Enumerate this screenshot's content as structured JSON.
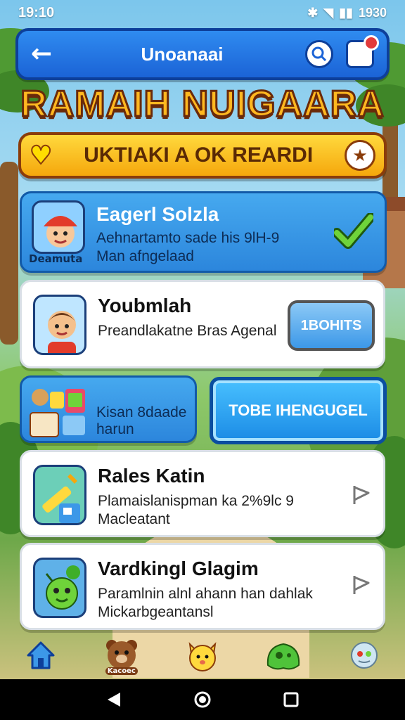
{
  "status_bar": {
    "time": "19:10",
    "right_time": "1930"
  },
  "header": {
    "title": "Unoanaai"
  },
  "game_title": "RAMAIH NUIGAARA",
  "banner": {
    "text": "UKTIAKI A OK REARDI"
  },
  "cards": [
    {
      "title": "Eagerl Solzla",
      "line1": "Aehnartamto sade his 9lH-9",
      "line2": "Man afngelaad",
      "avatar_label": "Deamuta"
    },
    {
      "title": "Youbmlah",
      "line1": "Preandlakatne Bras Agenal",
      "button": "1BOHITS"
    },
    {
      "line1": "Kisan 8daade",
      "line2": "harun",
      "button": "TOBE IHENGUGEL"
    },
    {
      "title": "Rales Katin",
      "line1": "Plamaislanispman ka 2%9lc 9",
      "line2": "Macleatant"
    },
    {
      "title": "Vardkingl Glagim",
      "line1": "Paramlnin alnl ahann han dahlak",
      "line2": "Mickarbgeantansl"
    }
  ],
  "bottom_nav": {
    "bear_label": "Kacoec"
  },
  "colors": {
    "header_blue": "#1b63d6",
    "banner_gold": "#f5a70c",
    "title_gold": "#ffb820"
  }
}
